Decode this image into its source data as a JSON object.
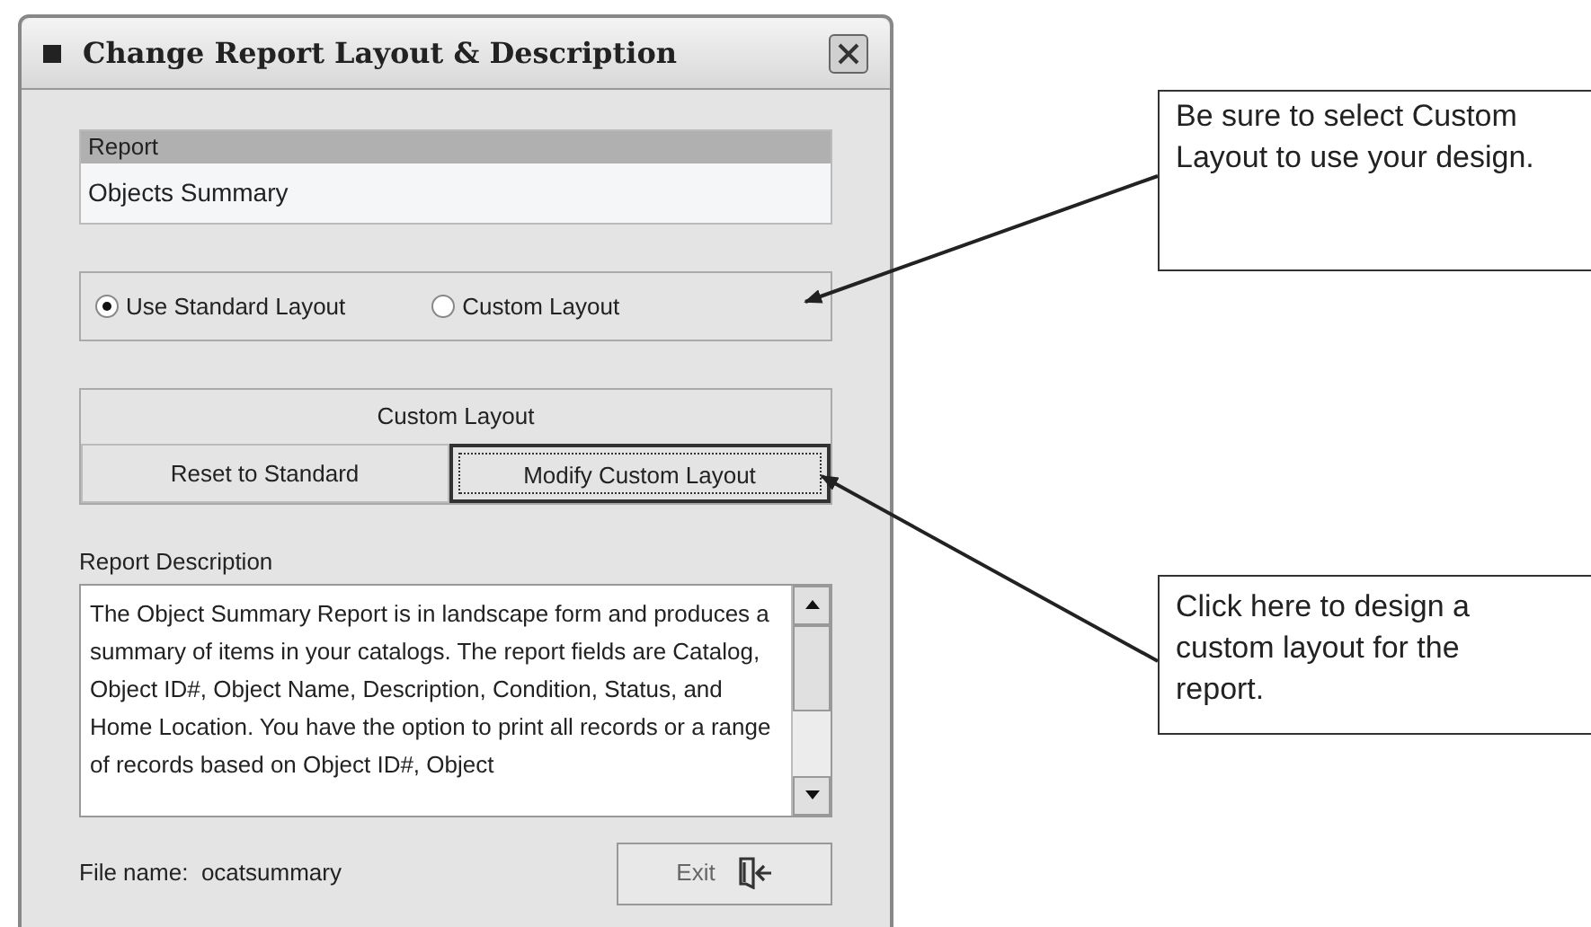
{
  "window": {
    "title": "Change Report Layout & Description"
  },
  "report": {
    "label": "Report",
    "value": "Objects Summary"
  },
  "layout_options": [
    {
      "label": "Use Standard Layout",
      "selected": true
    },
    {
      "label": "Custom Layout",
      "selected": false
    }
  ],
  "custom_layout": {
    "title": "Custom Layout",
    "buttons": [
      {
        "label": "Reset to Standard",
        "focused": false
      },
      {
        "label": "Modify Custom Layout",
        "focused": true
      }
    ]
  },
  "description": {
    "label": "Report Description",
    "text": "The Object Summary Report is in landscape form and produces a summary of items in your catalogs. The report fields are Catalog, Object ID#, Object Name, Description, Condition, Status, and Home Location. You have the option to print all records or a range of records based on Object ID#, Object"
  },
  "file_name": {
    "label": "File name:",
    "value": "ocatsummary"
  },
  "exit_button": {
    "label": "Exit"
  },
  "callouts": [
    {
      "text": "Be sure to select Custom Layout to use your design."
    },
    {
      "text": "Click here to design a custom layout for the report."
    }
  ]
}
